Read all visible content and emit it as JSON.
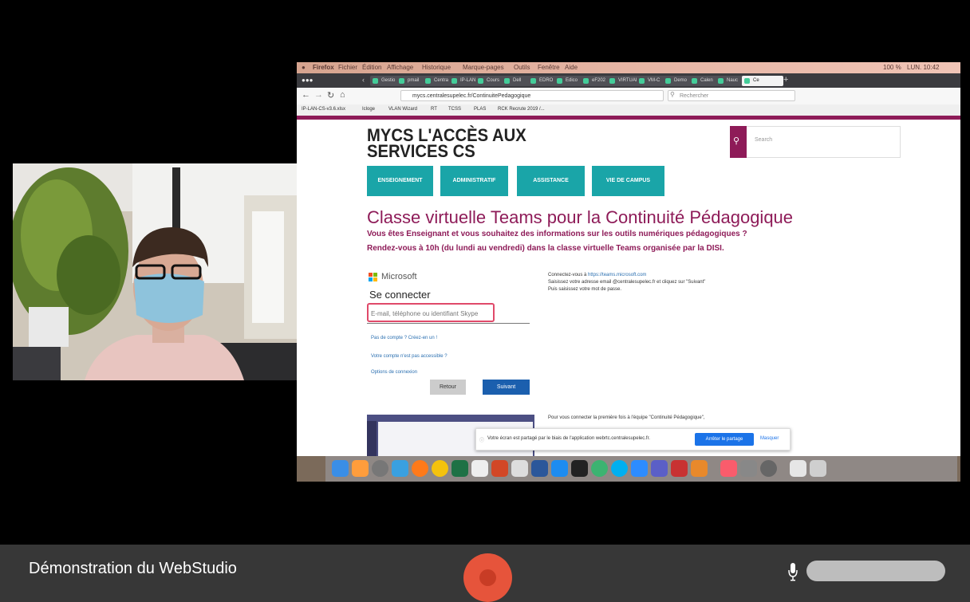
{
  "window": {
    "caption": "Démonstration du WebStudio"
  },
  "shared_screen": {
    "mac_menubar": [
      "Firefox",
      "Fichier",
      "Édition",
      "Affichage",
      "Historique",
      "Marque-pages",
      "Outils",
      "Fenêtre",
      "Aide"
    ],
    "mac_status": [
      "100 %",
      "LUN. 10:42"
    ],
    "tabs": [
      "Gestio",
      "pmail",
      "Centra",
      "IP-LAN",
      "Cours",
      "Dell",
      "EDRO",
      "Edico",
      "eF202",
      "VIRTUAL",
      "VM-C",
      "Demo",
      "Calen",
      "Nauc",
      "Ce"
    ],
    "url": "mycs.centralesupelec.fr/ContinuitePedagogique",
    "search_placeholder": "Rechercher",
    "bookmarks": [
      "IP-LAN-CS-v3.6.xlsx",
      "Icloge",
      "VLAN Wizard",
      "RT",
      "TCSS",
      "PLAS",
      "RCK Recrute 2019 /..."
    ],
    "site": {
      "title_line1": "MYCS L'ACCÈS AUX",
      "title_line2": "SERVICES CS",
      "search_placeholder": "Search",
      "nav": [
        "ENSEIGNEMENT",
        "ADMINISTRATIF",
        "ASSISTANCE",
        "VIE DE CAMPUS"
      ],
      "heading": "Classe virtuelle Teams pour la Continuité Pédagogique",
      "subheading_1": "Vous êtes Enseignant et vous souhaitez des informations sur les outils numériques pédagogiques ?",
      "subheading_2": "Rendez-vous à 10h (du lundi au vendredi) dans la classe virtuelle Teams organisée par la DISI.",
      "ms_brand": "Microsoft",
      "signin_title": "Se connecter",
      "email_placeholder": "E-mail, téléphone ou identifiant Skype",
      "link_no_account": "Pas de compte ? Créez-en un !",
      "link_not_accessible": "Votre compte n'est pas accessible ?",
      "link_options": "Options de connexion",
      "btn_back": "Retour",
      "btn_next": "Suivant",
      "instr_1_prefix": "Connectez-vous à",
      "instr_1_link": "https://teams.microsoft.com",
      "instr_2": "Saisissez votre adresse email @centralesupelec.fr et cliquez sur \"Suivant\"",
      "instr_3": "Puis saisissez votre mot de passe.",
      "instr_4": "Pour vous connecter la première fois à l'équipe \"Continuité Pédagogique\","
    },
    "share_banner": {
      "text": "Votre écran est partagé par le biais de l'application webrtc.centralesupelec.fr.",
      "stop": "Arrêter le partage",
      "hide": "Masquer"
    }
  },
  "colors": {
    "accent": "#8e1b58",
    "nav": "#1aa5a8",
    "record": "#e6543b",
    "bottombar": "#373737"
  }
}
